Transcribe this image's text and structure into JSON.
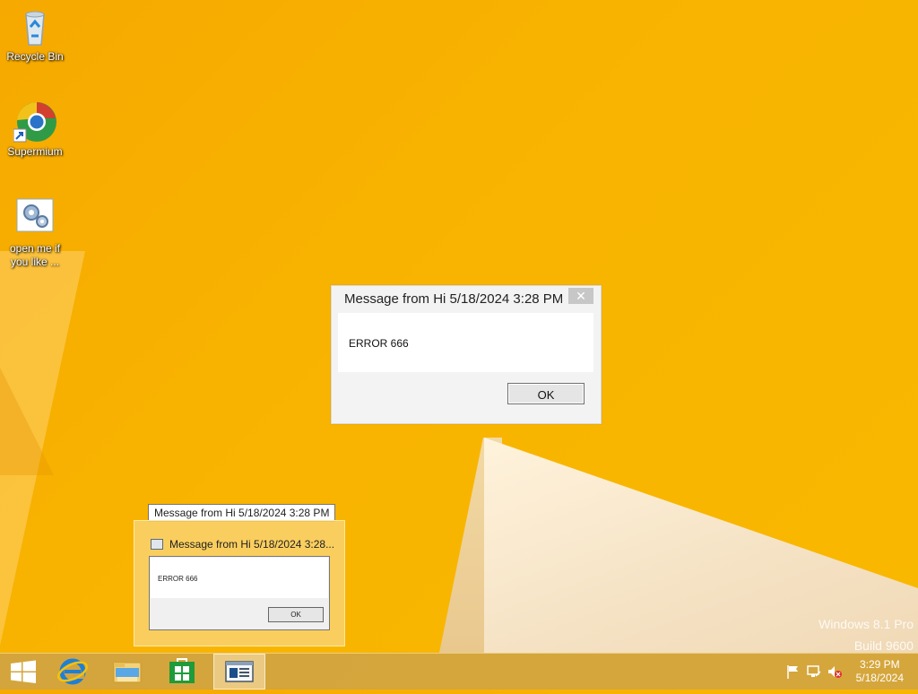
{
  "desktop": {
    "icons": [
      {
        "label": "Recycle Bin",
        "icon": "recycle-bin-icon"
      },
      {
        "label": "Supermium",
        "icon": "supermium-browser-icon"
      },
      {
        "label": "open me if\nyou like ...",
        "icon": "gear-document-icon"
      }
    ]
  },
  "dialog": {
    "title": "Message from Hi 5/18/2024 3:28 PM",
    "close_label": "✕",
    "message": "ERROR 666",
    "ok_label": "OK"
  },
  "taskbar_preview": {
    "tooltip": "Message from Hi 5/18/2024 3:28 PM",
    "window_title": "Message from Hi 5/18/2024 3:28...",
    "message": "ERROR 666",
    "ok_label": "OK"
  },
  "watermark": {
    "line1": "Windows 8.1 Pro",
    "line2": "Build 9600"
  },
  "taskbar": {
    "buttons": [
      "start-button",
      "internet-explorer-icon",
      "file-explorer-icon",
      "store-icon",
      "message-window-icon"
    ],
    "tray": {
      "time": "3:29 PM",
      "date": "5/18/2024"
    }
  },
  "colors": {
    "wallpaper": "#f8b400",
    "accent_store": "#1f9b3a",
    "ie_blue": "#1e7fd6"
  }
}
